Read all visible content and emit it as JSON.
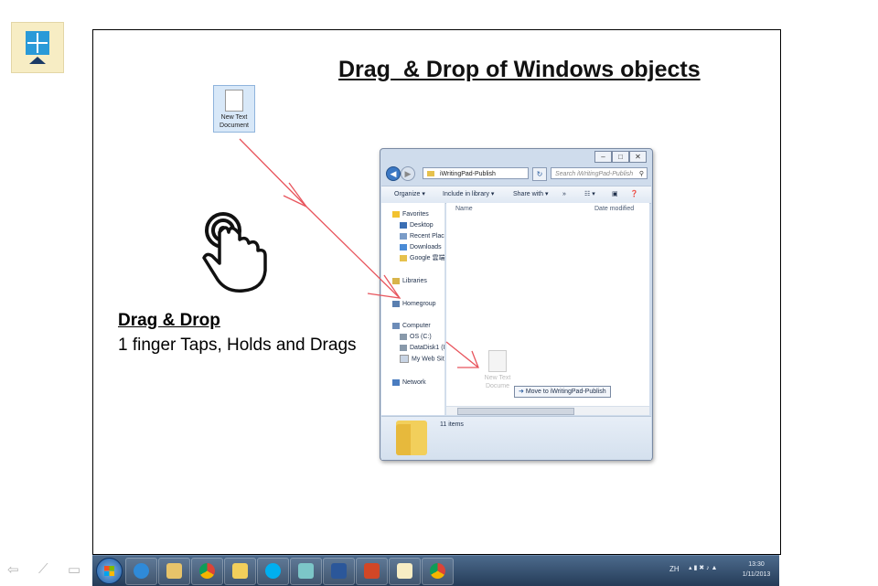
{
  "slide": {
    "title": "Drag  & Drop of Windows objects",
    "gesture_title": "Drag & Drop",
    "gesture_desc": "1 finger Taps, Holds and Drags"
  },
  "desktop_icon": {
    "label_line1": "New Text",
    "label_line2": "Document"
  },
  "explorer": {
    "address": "iWritingPad-Publish",
    "search_placeholder": "Search iWritingPad-Publish",
    "window_buttons": [
      "–",
      "□",
      "✕"
    ],
    "toolbar": [
      "Organize ▾",
      "Include in library ▾",
      "Share with ▾",
      "»"
    ],
    "nav": {
      "favorites": "Favorites",
      "desktop": "Desktop",
      "recent": "Recent Plac",
      "downloads": "Downloads",
      "google": "Google 雲端",
      "libraries": "Libraries",
      "homegroup": "Homegroup",
      "computer": "Computer",
      "os": "OS (C:)",
      "datadisk": "DataDisk1 (I",
      "myweb": "My Web Sit",
      "network": "Network"
    },
    "columns": {
      "name": "Name",
      "date": "Date modified"
    },
    "ghost_label_line1": "New Text",
    "ghost_label_line2": "Docume",
    "drag_tooltip": "Move to iWritingPad-Publish",
    "status": "11 items"
  },
  "slide_nav": [
    "⇦",
    "⟋",
    "▭"
  ],
  "taskbar": {
    "apps": [
      "ie-icon",
      "paint-icon",
      "chrome-icon",
      "folder-icon",
      "skype-icon",
      "notepad-icon",
      "word-icon",
      "powerpoint-icon",
      "writingpad-icon",
      "chrome2-icon"
    ],
    "language": "ZH",
    "time": "13:30",
    "date": "1/11/2013"
  },
  "colors": {
    "drag_arrow": "#e8555d",
    "slide_border": "#000000",
    "app_icon_bg": "#f7edc4"
  }
}
